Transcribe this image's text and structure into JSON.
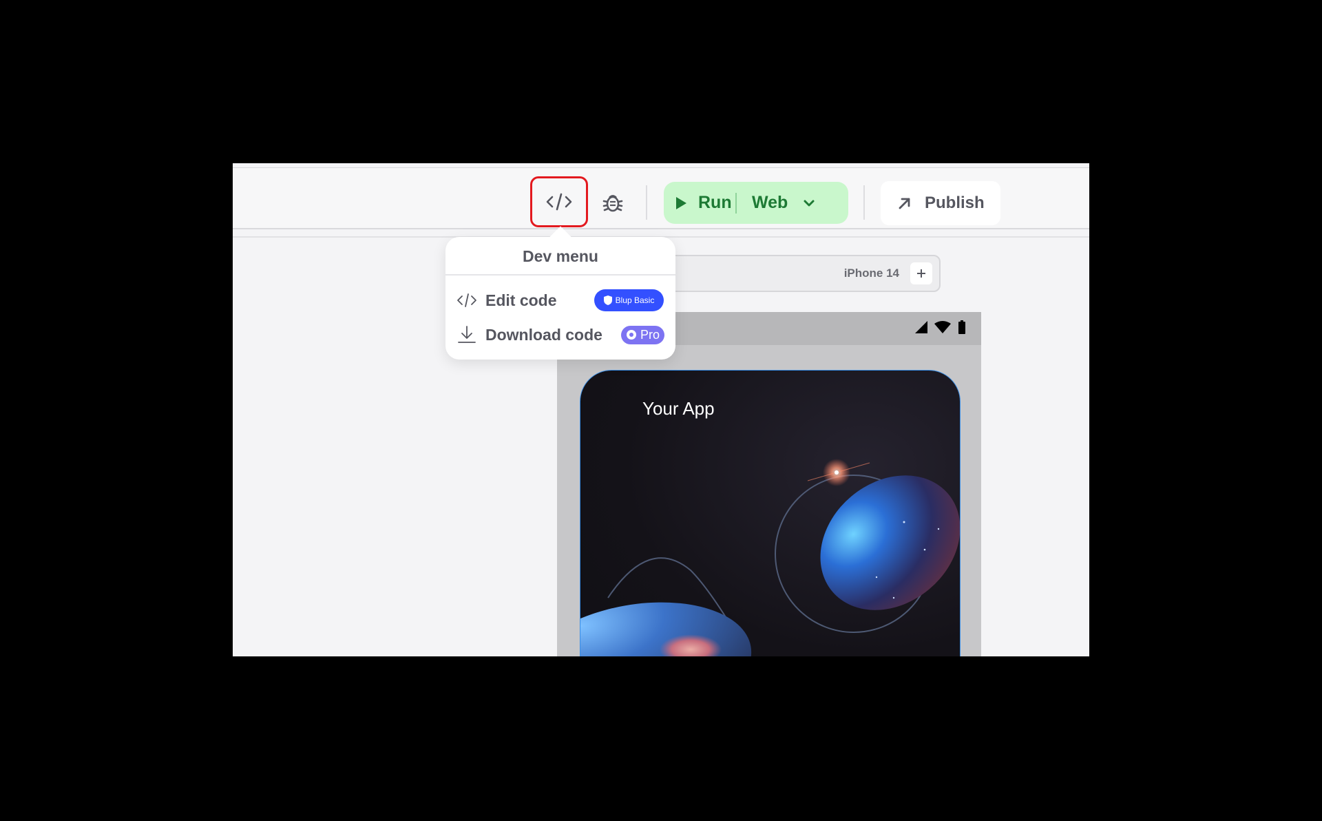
{
  "toolbar": {
    "code_icon": "code-icon",
    "debug_icon": "bug-icon",
    "run": {
      "label": "Run",
      "icon": "play-icon"
    },
    "platform": {
      "value": "Web",
      "icon": "chevron-down-icon"
    },
    "publish": {
      "label": "Publish",
      "icon": "arrow-up-right-icon"
    }
  },
  "dev_menu": {
    "title": "Dev menu",
    "items": [
      {
        "label": "Edit code",
        "icon": "code-icon",
        "badge": "Blup Basic"
      },
      {
        "label": "Download code",
        "icon": "download-icon",
        "badge": "Pro"
      }
    ]
  },
  "device": {
    "name": "iPhone 14",
    "add_icon": "plus-icon"
  },
  "preview": {
    "title": "Your App"
  },
  "colors": {
    "highlight": "#e3191f",
    "run_bg": "#c9f7cc",
    "run_text": "#1d7a34",
    "badge_basic": "#3350ff",
    "badge_pro": "#7d73f2"
  }
}
